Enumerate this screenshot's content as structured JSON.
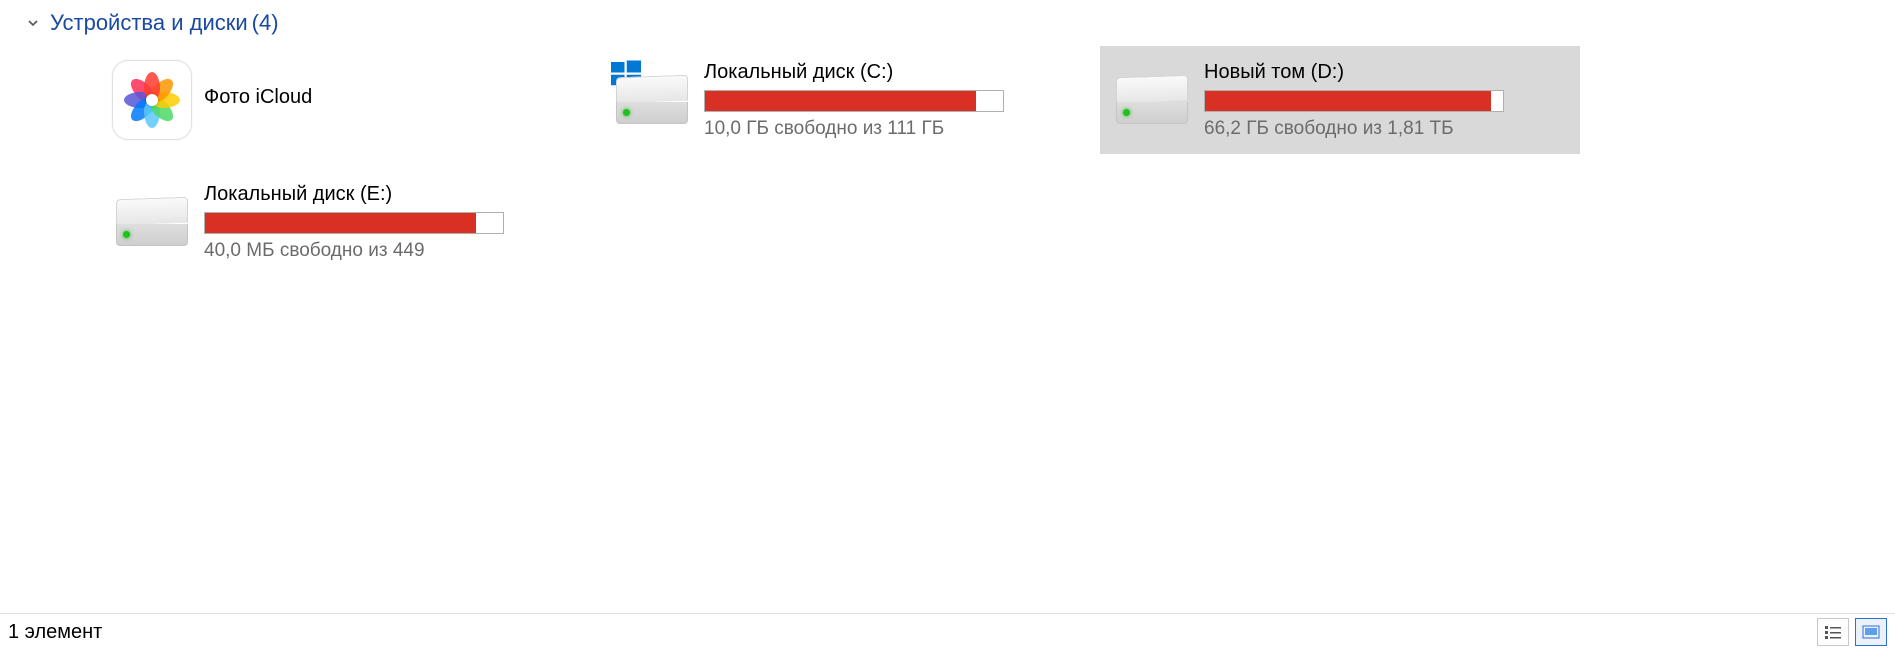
{
  "group": {
    "title": "Устройства и диски",
    "count": "(4)"
  },
  "items": [
    {
      "kind": "app",
      "name": "Фото iCloud"
    },
    {
      "kind": "drive",
      "os": true,
      "name": "Локальный диск (C:)",
      "free_text": "10,0 ГБ свободно из 111 ГБ",
      "used_pct": 91,
      "bar_color": "#d93025"
    },
    {
      "kind": "drive",
      "selected": true,
      "name": "Новый том (D:)",
      "free_text": "66,2 ГБ свободно из 1,81 ТБ",
      "used_pct": 96,
      "bar_color": "#d93025"
    },
    {
      "kind": "drive",
      "name": "Локальный диск (E:)",
      "free_text": "40,0 МБ свободно из 449",
      "used_pct": 91,
      "bar_color": "#d93025"
    }
  ],
  "statusbar": {
    "text": "1 элемент"
  },
  "petal_colors": [
    "#ff3b30",
    "#ff9500",
    "#ffcc00",
    "#4cd964",
    "#5ac8fa",
    "#007aff",
    "#5856d6",
    "#ff2d55"
  ]
}
